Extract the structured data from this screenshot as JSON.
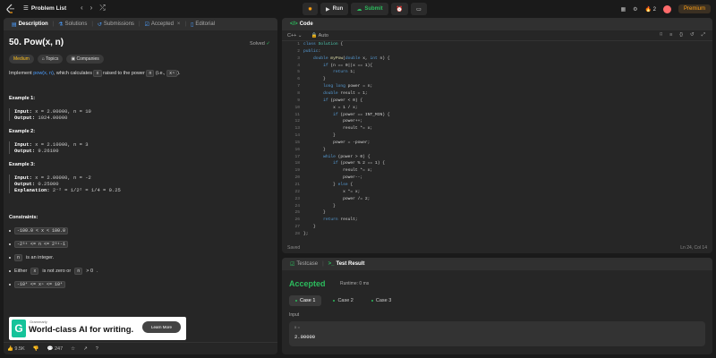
{
  "topbar": {
    "problem_list": "Problem List",
    "run": "Run",
    "submit": "Submit",
    "streak": "2",
    "premium": "Premium"
  },
  "left": {
    "tabs": [
      "Description",
      "Solutions",
      "Submissions",
      "Accepted",
      "Editorial"
    ],
    "title": "50. Pow(x, n)",
    "solved": "Solved",
    "tags": [
      "Medium",
      "Topics",
      "Companies"
    ],
    "intro": {
      "a": "Implement",
      "link": "pow(x, n)",
      "b": ", which calculates",
      "c1": "x",
      "d": "raised to the power",
      "c2": "n",
      "e": "(i.e.,",
      "c3": "xⁿ",
      "f": ")."
    },
    "examples": [
      {
        "title": "Example 1:",
        "input": "x = 2.00000, n = 10",
        "output": "1024.00000",
        "explanation": ""
      },
      {
        "title": "Example 2:",
        "input": "x = 2.10000, n = 3",
        "output": "9.26100",
        "explanation": ""
      },
      {
        "title": "Example 3:",
        "input": "x = 2.00000, n = -2",
        "output": "0.25000",
        "explanation": "2⁻² = 1/2² = 1/4 = 0.25"
      }
    ],
    "labels": {
      "input": "Input:",
      "output": "Output:",
      "explanation": "Explanation:"
    },
    "constraints_title": "Constraints:",
    "constraints": [
      {
        "code": "-100.0 < x < 100.0",
        "text": ""
      },
      {
        "code": "-2³¹ <= n <= 2³¹-1",
        "text": ""
      },
      {
        "code": "n",
        "text": "is an integer."
      },
      {
        "code": "",
        "text": "Either"
      },
      {
        "code": "-10⁴ <= xⁿ <= 10⁴",
        "text": ""
      }
    ],
    "either": {
      "a": "Either",
      "c1": "x",
      "b": "is not zero or",
      "c2": "n",
      "c3": "> 0",
      "d": "."
    },
    "ad": {
      "brand": "Grammarly",
      "text": "World-class AI for writing.",
      "button": "Learn More",
      "logo": "G"
    },
    "footer": {
      "likes": "9.5K",
      "comments": "247"
    }
  },
  "code": {
    "title": "Code",
    "language": "C++",
    "auto": "Auto",
    "status": "Saved",
    "position": "Ln 24, Col 14",
    "lines": [
      "class Solution {",
      "public:",
      "    double myPow(double x, int n) {",
      "        if (n == 0||x == 1){",
      "            return 1;",
      "        }",
      "        long long power = n;",
      "        double result = 1;",
      "        if (power < 0) {",
      "            x = 1 / x;",
      "            if (power == INT_MIN) {",
      "                power++;",
      "                result *= x;",
      "            }",
      "            power = -power;",
      "        }",
      "        while (power > 0) {",
      "            if (power % 2 == 1) {",
      "                result *= x;",
      "                power--;",
      "            } else {",
      "                x *= x;",
      "                power /= 2;",
      "            }",
      "        }",
      "        return result;",
      "    }",
      "};"
    ]
  },
  "test": {
    "tabs": [
      "Testcase",
      "Test Result"
    ],
    "accepted": "Accepted",
    "runtime": "Runtime: 0 ms",
    "cases": [
      "Case 1",
      "Case 2",
      "Case 3"
    ],
    "input_label": "Input",
    "var": "x =",
    "value": "2.00000"
  },
  "colors": {
    "accent": "#ffa116",
    "green": "#2cbb5d",
    "link": "#4b9eff"
  }
}
